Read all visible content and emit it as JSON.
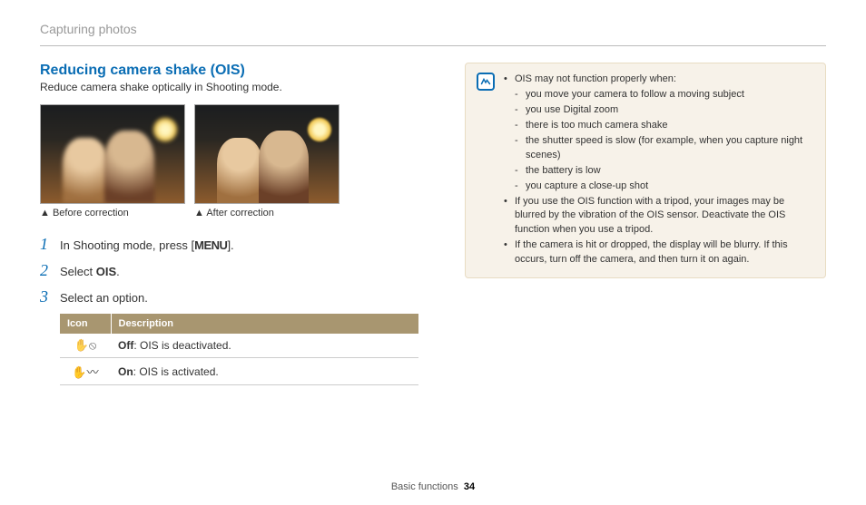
{
  "header": {
    "section": "Capturing photos"
  },
  "left": {
    "title": "Reducing camera shake (OIS)",
    "intro": "Reduce camera shake optically in Shooting mode.",
    "caption_before": "▲ Before correction",
    "caption_after": "▲ After correction",
    "steps": {
      "s1_pre": "In Shooting mode, press [",
      "s1_menu": "MENU",
      "s1_post": "].",
      "s2_pre": "Select ",
      "s2_bold": "OIS",
      "s2_post": ".",
      "s3": "Select an option."
    },
    "table": {
      "head_icon": "Icon",
      "head_desc": "Description",
      "rows": [
        {
          "icon_glyph": "✋⦸",
          "label_bold": "Off",
          "label_rest": ": OIS is deactivated."
        },
        {
          "icon_glyph": "✋〰",
          "label_bold": "On",
          "label_rest": ": OIS is activated."
        }
      ]
    }
  },
  "note": {
    "bullets": [
      {
        "text": "OIS may not function properly when:",
        "sub": [
          "you move your camera to follow a moving subject",
          "you use Digital zoom",
          "there is too much camera shake",
          "the shutter speed is slow (for example, when you capture night scenes)",
          "the battery is low",
          "you capture a close-up shot"
        ]
      },
      {
        "text": "If you use the OIS function with a tripod, your images may be blurred by the vibration of the OIS sensor. Deactivate the OIS function when you use a tripod."
      },
      {
        "text": "If the camera is hit or dropped, the display will be blurry. If this occurs, turn off the camera, and then turn it on again."
      }
    ]
  },
  "footer": {
    "label": "Basic functions",
    "page": "34"
  }
}
